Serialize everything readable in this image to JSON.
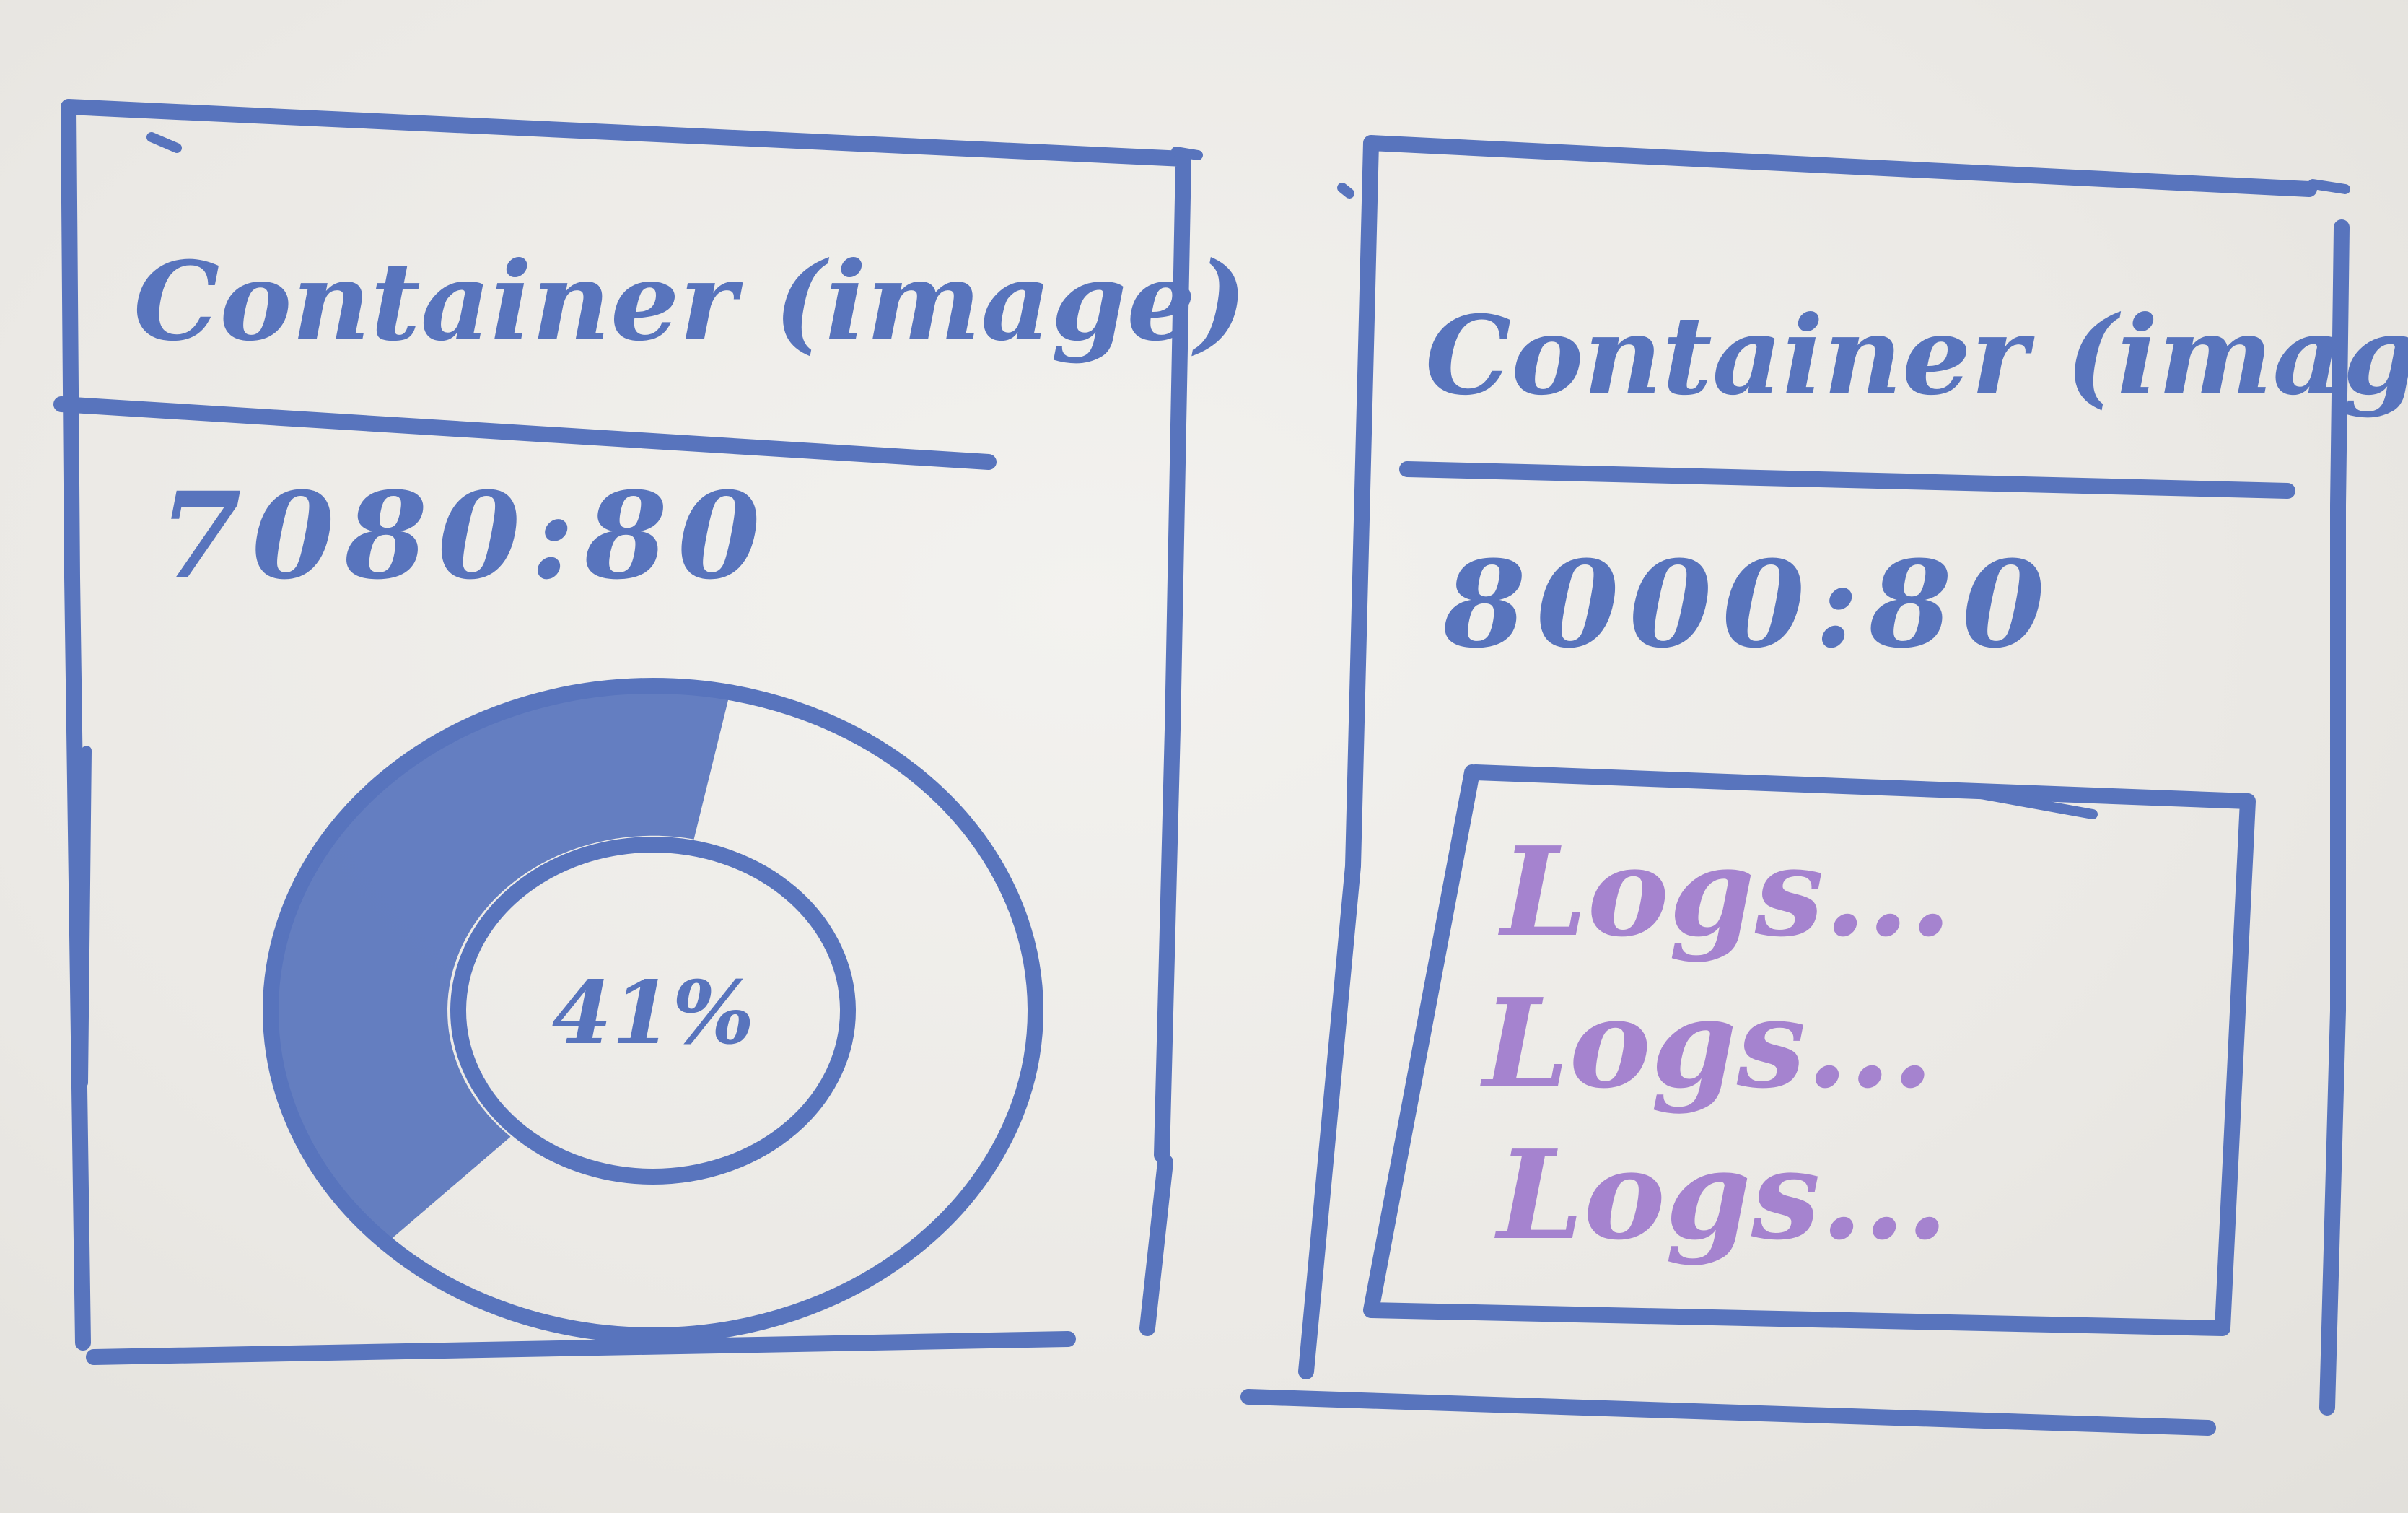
{
  "containers": [
    {
      "title": "Container (image)",
      "port": "7080:80",
      "usage": {
        "label": "41%",
        "fraction": 0.41
      }
    },
    {
      "title": "Container (image)",
      "port": "8000:80",
      "logs": [
        "Logs...",
        "Logs...",
        "Logs..."
      ]
    }
  ],
  "colors": {
    "marker_blue": "#5874bd",
    "marker_purple": "#a583cf",
    "board": "#eceae6"
  }
}
